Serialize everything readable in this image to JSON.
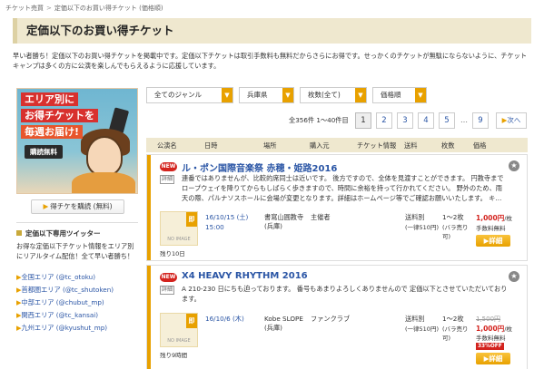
{
  "breadcrumb": {
    "home": "チケット売買",
    "current": "定価以下のお買い得チケット (価格順)"
  },
  "page_title": "定価以下のお買い得チケット",
  "intro": "早い者勝ち！定価以下のお買い得チケットを掲載中です。定価以下チケットは取引手数料も無料だからさらにお得です。せっかくのチケットが無駄にならないように、チケットキャンプは多くの方に公演を楽しんでもらえるように応援しています。",
  "banner": {
    "line1": "エリア別に",
    "line2": "お得チケットを",
    "line3": "毎週お届け!",
    "button": "購読無料"
  },
  "subscribe_button": "得チケを購読 (無料)",
  "sidebar": {
    "twitter_heading": "定価以下専用ツイッター",
    "twitter_desc": "お得な定価以下チケット情報をエリア別にリアルタイム配信！全て早い者勝ち！",
    "areas": [
      {
        "label": "全国エリア (@tc_otoku)"
      },
      {
        "label": "首都圏エリア (@tc_shutoken)"
      },
      {
        "label": "中部エリア (@chubut_mp)"
      },
      {
        "label": "関西エリア (@tc_kansai)"
      },
      {
        "label": "九州エリア (@kyushut_mp)"
      }
    ]
  },
  "filters": {
    "genre": "全てのジャンル",
    "pref": "兵庫県",
    "qty": "枚数(全て)",
    "sort": "価格順"
  },
  "pagination": {
    "count": "全356件 1〜40件目",
    "pages": [
      "1",
      "2",
      "3",
      "4",
      "5"
    ],
    "dots": "…",
    "last": "9",
    "next": "次へ"
  },
  "table_headers": {
    "status": "公演名",
    "date": "日時",
    "venue": "場所",
    "seller": "購入元",
    "ticket_info": "チケット情報",
    "shipping": "送料",
    "qty": "枚数",
    "price": "価格"
  },
  "rows": [
    {
      "new": "NEW",
      "title": "ル・ポン国際音楽祭 赤穂・姫路2016",
      "detail_tag": "詳細",
      "desc": "連番ではありませんが、比較的席同士は近いです。 後方ですので、全体を見渡すことができます。 円教寺までロープウェイを降りてからもしばらく歩きますので、時間に余裕を持って行かれてください。 野外のため、雨天の際、パルナソスホールに会場が変更となります。詳細はホームページ等でご確認お願いいたします。 キ…",
      "badge": "即",
      "noimage": "NO IMAGE",
      "remain": "残り10日",
      "date": "16/10/15 (土)",
      "time": "15:00",
      "venue": "書寫山圓教寺 (兵庫)",
      "seller": "主催者",
      "shipping_label": "送料別",
      "shipping_detail": "(一律510円)",
      "qty": "1〜2枚",
      "qty_detail": "(バラ売り可)",
      "price": "1,000円",
      "price_unit": "/枚",
      "fee_free": "手数料無料",
      "detail_button": "詳細"
    },
    {
      "new": "NEW",
      "title": "X4 HEAVY RHYTHM 2016",
      "detail_tag": "詳細",
      "desc": "A 210-230 日にちも迫っております。 番号もあまりよろしくありませんので 定価以下とさせていただいております。",
      "badge": "即",
      "noimage": "NO IMAGE",
      "remain": "残り9時間",
      "date": "16/10/6 (木)",
      "time": "",
      "venue": "Kobe SLOPE (兵庫)",
      "seller": "ファンクラブ",
      "shipping_label": "送料別",
      "shipping_detail": "(一律510円)",
      "qty": "1〜2枚",
      "qty_detail": "(バラ売り可)",
      "orig_price": "1,500円",
      "price": "1,000円",
      "price_unit": "/枚",
      "fee_free": "手数料無料",
      "off": "33%OFF",
      "detail_button": "詳細"
    }
  ],
  "colors": {
    "accent": "#e8a100",
    "link": "#2a55a5",
    "new": "#d3231e",
    "header_bg": "#efe8cf"
  }
}
